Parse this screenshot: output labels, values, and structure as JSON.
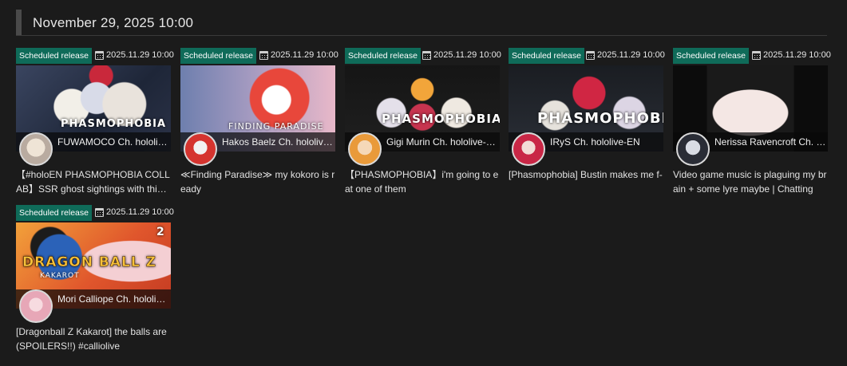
{
  "section": {
    "title": "November 29, 2025 10:00"
  },
  "cards": [
    {
      "badge": "Scheduled release",
      "date": "2025.11.29 10:00",
      "channel": "FUWAMOCO Ch. hololive-EN",
      "title": "【#holoEN PHASMOPHOBIA COLLAB】SSR ghost sightings with this crew",
      "thumb_text": "PHASMOPHOBIA",
      "calendar_icon": "calendar-icon"
    },
    {
      "badge": "Scheduled release",
      "date": "2025.11.29 10:00",
      "channel": "Hakos Baelz Ch. hololive-EN",
      "title": "≪Finding Paradise≫ my kokoro is ready",
      "thumb_text": "FINDING PARADISE",
      "calendar_icon": "calendar-icon"
    },
    {
      "badge": "Scheduled release",
      "date": "2025.11.29 10:00",
      "channel": "Gigi Murin Ch. hololive-EN",
      "title": "【PHASMOPHOBIA】i'm going to eat one of them",
      "thumb_text": "PHASMOPHOBIA",
      "calendar_icon": "calendar-icon"
    },
    {
      "badge": "Scheduled release",
      "date": "2025.11.29 10:00",
      "channel": "IRyS Ch. hololive-EN",
      "title": "[Phasmophobia] Bustin makes me f-",
      "thumb_text": "PHASMOPHOBIA",
      "calendar_icon": "calendar-icon"
    },
    {
      "badge": "Scheduled release",
      "date": "2025.11.29 10:00",
      "channel": "Nerissa Ravencroft Ch. hololive-EN",
      "title": "Video game music is plaguing my brain + some lyre maybe | Chatting",
      "thumb_text": "",
      "calendar_icon": "calendar-icon"
    },
    {
      "badge": "Scheduled release",
      "date": "2025.11.29 10:00",
      "channel": "Mori Calliope Ch. hololive-EN",
      "title": "[Dragonball Z Kakarot] the balls are (SPOILERS!!) #calliolive",
      "thumb_text": "DRAGON BALL Z",
      "thumb_subtext": "KAKAROT",
      "thumb_number": "2",
      "calendar_icon": "calendar-icon"
    }
  ],
  "colors": {
    "background": "#1b1b1b",
    "badge": "#0f6b59",
    "text": "#e6e6e6"
  }
}
